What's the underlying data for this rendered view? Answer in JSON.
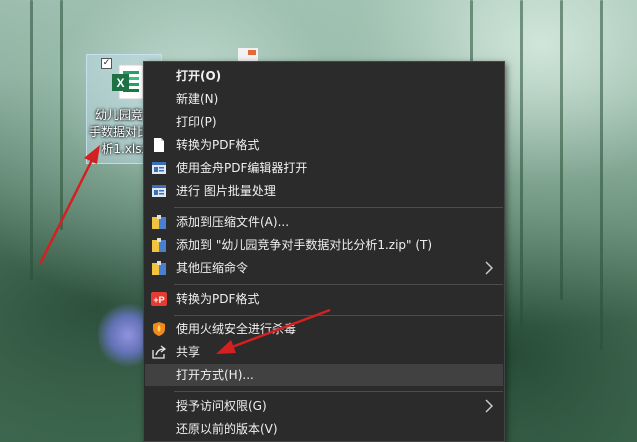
{
  "desktop": {
    "file_icon": {
      "name_line1": "幼儿园竞争",
      "name_line2": "手数据对比分",
      "name_line3": "析1.xlsx",
      "icon": "excel-file-icon",
      "checkbox_mark": "✓"
    },
    "peek_icon": "pdf-file-icon"
  },
  "menu": {
    "items": [
      {
        "label": "打开(O)",
        "icon": "",
        "bold": true
      },
      {
        "label": "新建(N)",
        "icon": ""
      },
      {
        "label": "打印(P)",
        "icon": ""
      },
      {
        "label": "转换为PDF格式",
        "icon": "blank-page-icon"
      },
      {
        "label": "使用金舟PDF编辑器打开",
        "icon": "jinzhou-pdf-editor-icon"
      },
      {
        "label": "进行 图片批量处理",
        "icon": "image-batch-icon"
      },
      {
        "label": "添加到压缩文件(A)...",
        "icon": "archive-icon"
      },
      {
        "label": "添加到 \"幼儿园竞争对手数据对比分析1.zip\" (T)",
        "icon": "archive-icon"
      },
      {
        "label": "其他压缩命令",
        "icon": "archive-icon",
        "submenu": true
      },
      {
        "label": "转换为PDF格式",
        "icon": "red-pdf-converter-icon"
      },
      {
        "label": "使用火绒安全进行杀毒",
        "icon": "huorong-shield-icon"
      },
      {
        "label": "共享",
        "icon": "share-icon"
      },
      {
        "label": "打开方式(H)...",
        "icon": "",
        "highlighted": true
      },
      {
        "label": "授予访问权限(G)",
        "icon": "",
        "submenu": true
      },
      {
        "label": "还原以前的版本(V)",
        "icon": ""
      }
    ]
  },
  "colors": {
    "menu_bg": "#2b2b2b",
    "menu_hover": "#414141",
    "menu_text": "#f0f0f0",
    "arrow": "#d42020",
    "excel_green": "#1e7145"
  }
}
